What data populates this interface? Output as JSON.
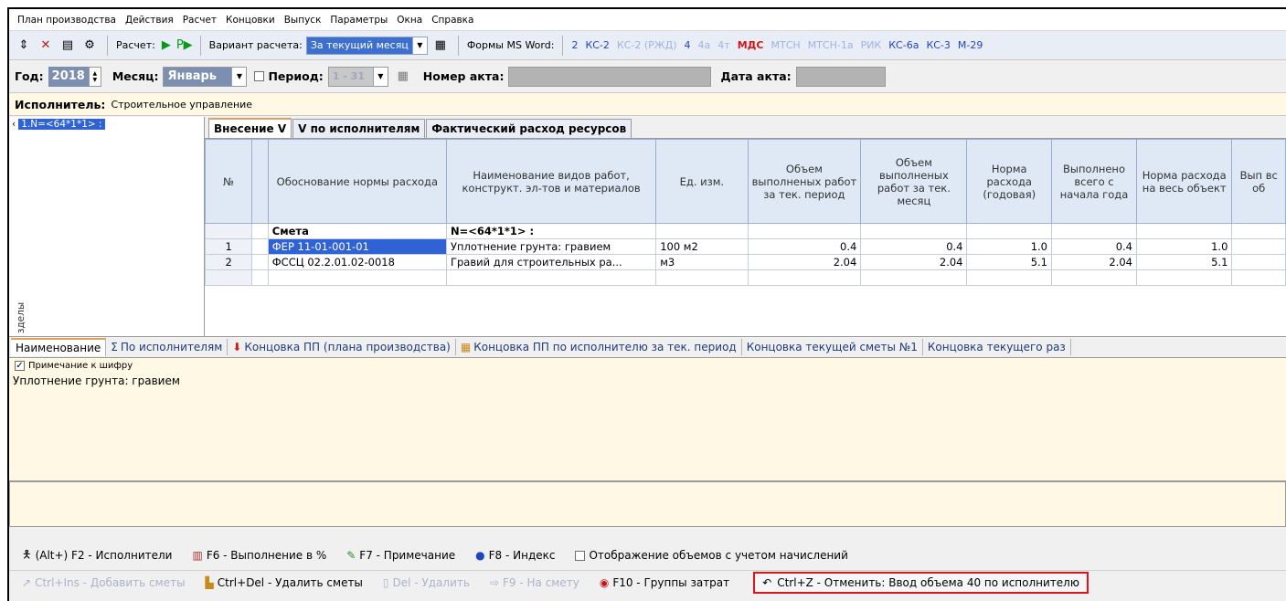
{
  "menu": [
    "План производства",
    "Действия",
    "Расчет",
    "Концовки",
    "Выпуск",
    "Параметры",
    "Окна",
    "Справка"
  ],
  "toolbar": {
    "calc_label": "Расчет:",
    "variant_label": "Вариант расчета:",
    "variant_value": "За текущий месяц",
    "forms_label": "Формы MS Word:",
    "forms": [
      {
        "t": "2",
        "s": "n"
      },
      {
        "t": "КС-2",
        "s": "n"
      },
      {
        "t": "КС-2 (РЖД)",
        "s": "d"
      },
      {
        "t": "4",
        "s": "n"
      },
      {
        "t": "4а",
        "s": "d"
      },
      {
        "t": "4т",
        "s": "d"
      },
      {
        "t": "МДС",
        "s": "r"
      },
      {
        "t": "МТСН",
        "s": "d"
      },
      {
        "t": "МТСН-1а",
        "s": "d"
      },
      {
        "t": "РИК",
        "s": "d"
      },
      {
        "t": "КС-6а",
        "s": "n"
      },
      {
        "t": "КС-3",
        "s": "n"
      },
      {
        "t": "М-29",
        "s": "n"
      }
    ]
  },
  "filter": {
    "year_label": "Год:",
    "year": "2018",
    "month_label": "Месяц:",
    "month": "Январь",
    "period_label": "Период:",
    "period": "1 - 31",
    "act_no_label": "Номер акта:",
    "act_date_label": "Дата акта:"
  },
  "executor": {
    "label": "Исполнитель:",
    "value": "Строительное управление"
  },
  "left": {
    "item": "1.N=<64*1*1> :",
    "vertical": "зделы"
  },
  "tabs": [
    "Внесение V",
    "V по исполнителям",
    "Фактический расход ресурсов"
  ],
  "grid": {
    "headers": [
      "№",
      "",
      "Обоснование нормы расхода",
      "Наименование видов работ, конструкт. эл-тов и материалов",
      "Ед. изм.",
      "Объем выполненых работ за тек. период",
      "Объем выполненых работ за тек. месяц",
      "Норма расхода (годовая)",
      "Выполнено всего с начала года",
      "Норма расхода на весь объект",
      "Вып вс об"
    ],
    "rows": [
      {
        "no": "",
        "flag": "",
        "base": "Смета",
        "name": "N=<64*1*1> :",
        "unit": "",
        "v1": "",
        "v2": "",
        "v3": "",
        "v4": "",
        "v5": ""
      },
      {
        "no": "1",
        "flag": "",
        "base": "ФЕР 11-01-001-01",
        "name": "Уплотнение грунта: гравием",
        "unit": "100 м2",
        "v1": "0.4",
        "v2": "0.4",
        "v3": "1.0",
        "v4": "0.4",
        "v5": "1.0"
      },
      {
        "no": "2",
        "flag": "",
        "base": "ФССЦ 02.2.01.02-0018",
        "name": "Гравий для строительных ра...",
        "unit": "м3",
        "v1": "2.04",
        "v2": "2.04",
        "v3": "5.1",
        "v4": "2.04",
        "v5": "5.1"
      }
    ]
  },
  "lower_tabs": [
    "Наименование",
    "По исполнителям",
    "Концовка ПП (плана производства)",
    "Концовка ПП по исполнителю за тек. период",
    "Концовка текущей сметы №1",
    "Концовка текущего раз"
  ],
  "note": {
    "checkbox": "Примечание к шифру",
    "text": "Уплотнение грунта: гравием"
  },
  "bottom1": [
    "(Alt+) F2 - Исполнители",
    "F6 - Выполнение в %",
    "F7 - Примечание",
    "F8 - Индекс",
    "Отображение объемов с учетом начислений"
  ],
  "bottom2": [
    "Ctrl+Ins - Добавить сметы",
    "Ctrl+Del - Удалить сметы",
    "Del - Удалить",
    "F9 - На смету",
    "F10 - Группы затрат"
  ],
  "undo": "Ctrl+Z - Отменить: Ввод объема 40 по исполнителю"
}
